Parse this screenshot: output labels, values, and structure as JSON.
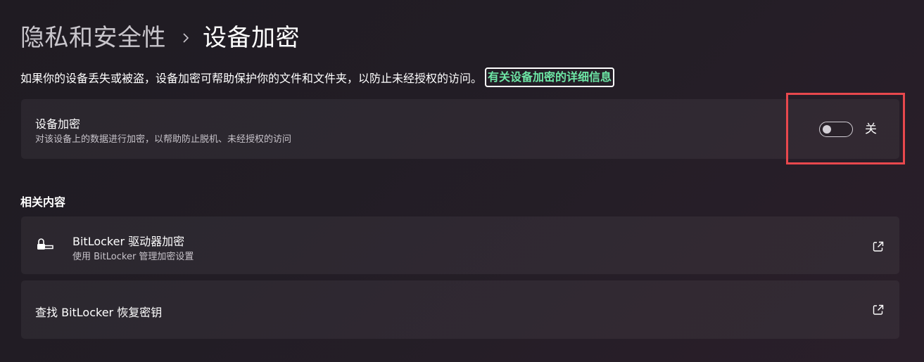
{
  "breadcrumb": {
    "parent": "隐私和安全性",
    "current": "设备加密"
  },
  "description": {
    "text": "如果你的设备丢失或被盗，设备加密可帮助保护你的文件和文件夹，以防止未经授权的访问。",
    "link": "有关设备加密的详细信息"
  },
  "device_encryption": {
    "title": "设备加密",
    "subtitle": "对该设备上的数据进行加密，以帮助防止脱机、未经授权的访问",
    "toggle_state": "关",
    "toggle_on": false
  },
  "related": {
    "heading": "相关内容",
    "items": [
      {
        "title": "BitLocker 驱动器加密",
        "subtitle": "使用 BitLocker 管理加密设置",
        "icon": "bitlocker-key-icon",
        "action_icon": "external-link-icon"
      },
      {
        "title": "查找 BitLocker 恢复密钥",
        "action_icon": "external-link-icon"
      }
    ]
  },
  "colors": {
    "link": "#6ee7a6",
    "highlight": "#e8484d"
  }
}
